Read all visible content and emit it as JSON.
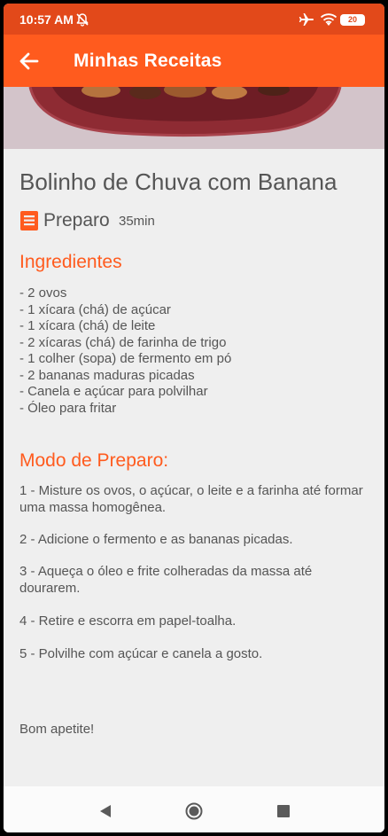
{
  "status_bar": {
    "time": "10:57 AM",
    "battery": "20",
    "icons": [
      "bell-off-icon",
      "airplane-icon",
      "wifi-icon",
      "battery-icon"
    ]
  },
  "app_bar": {
    "title": "Minhas Receitas",
    "back_icon": "arrow-left-icon"
  },
  "colors": {
    "status_bar": "#e2491a",
    "app_bar": "#ff5b1e",
    "accent": "#ff5b1e",
    "text": "#555555",
    "background": "#efefef"
  },
  "recipe": {
    "title": "Bolinho de Chuva com Banana",
    "prep_label": "Preparo",
    "prep_time": "35min",
    "ingredients_heading": "Ingredientes",
    "ingredients": [
      "- 2 ovos",
      "- 1 xícara (chá) de açúcar",
      "- 1 xícara (chá) de leite",
      "- 2 xícaras (chá) de farinha de trigo",
      "- 1 colher (sopa) de fermento em pó",
      "- 2 bananas maduras picadas",
      "- Canela e açúcar para polvilhar",
      "- Óleo para fritar"
    ],
    "method_heading": "Modo de Preparo:",
    "steps": [
      "1 - Misture os ovos, o açúcar, o leite e a farinha até formar uma massa homogênea.",
      "2 - Adicione o fermento e as bananas picadas.",
      "3 - Aqueça o óleo e frite colheradas da massa até dourarem.",
      "4 - Retire e escorra em papel-toalha.",
      "5 - Polvilhe com açúcar e canela a gosto."
    ],
    "closing": "Bom apetite!"
  },
  "nav_bar": {
    "icons": [
      "nav-back-icon",
      "nav-home-icon",
      "nav-recents-icon"
    ]
  }
}
